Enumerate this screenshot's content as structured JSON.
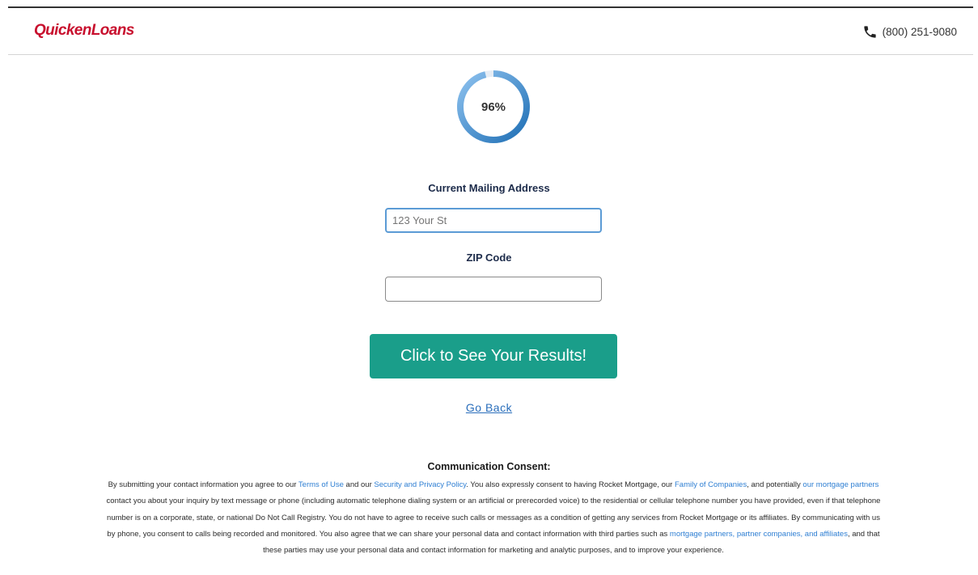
{
  "header": {
    "logo": "QuickenLoans",
    "phone": "(800) 251-9080",
    "phone_icon": "phone-icon"
  },
  "progress": {
    "value": 96,
    "label": "96%",
    "colors": {
      "start": "#1f6fb5",
      "end": "#8ec2ef",
      "track": "#e6edf5"
    }
  },
  "form": {
    "address_label": "Current Mailing Address",
    "address_placeholder": "123 Your St",
    "address_value": "",
    "zip_label": "ZIP Code",
    "zip_placeholder": "",
    "zip_value": "",
    "submit_label": "Click to See Your Results!",
    "back_label": "Go Back"
  },
  "consent": {
    "title": "Communication Consent:",
    "t1": "By submitting your contact information you agree to our ",
    "link_terms": "Terms of Use",
    "t2": " and our ",
    "link_privacy": "Security and Privacy Policy",
    "t3": ". You also expressly consent to having Rocket Mortgage, our ",
    "link_family": "Family of Companies",
    "t4": ", and potentially ",
    "link_partners": "our mortgage partners",
    "t5": " contact you about your inquiry by text message or phone (including automatic telephone dialing system or an artificial or prerecorded voice) to the residential or cellular telephone number you have provided, even if that telephone number is on a corporate, state, or national Do Not Call Registry. You do not have to agree to receive such calls or messages as a condition of getting any services from Rocket Mortgage or its affiliates. By communicating with us by phone, you consent to calls being recorded and monitored. You also agree that we can share your personal data and contact information with third parties such as ",
    "link_third": "mortgage partners, partner companies, and affiliates",
    "t6": ", and that these parties may use your personal data and contact information for marketing and analytic purposes, and to improve your experience."
  },
  "colors": {
    "brand": "#c8102e",
    "cta": "#1a9e8a",
    "link": "#2f7fd3"
  }
}
